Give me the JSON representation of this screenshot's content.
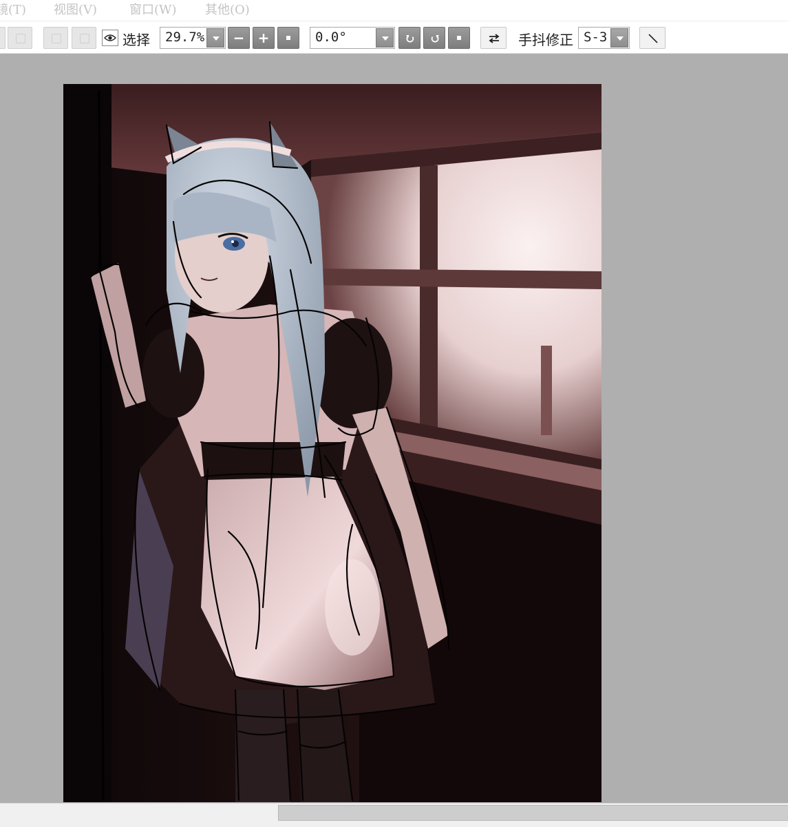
{
  "menu": {
    "items": [
      "镜(T)",
      "视图(V)",
      "窗口(W)",
      "其他(O)"
    ]
  },
  "toolbar": {
    "select_label": "选择",
    "zoom_value": "29.7%",
    "zoom_out_symbol": "−",
    "zoom_in_symbol": "+",
    "rotation_value": "0.0°",
    "stabilizer_label": "手抖修正",
    "stabilizer_value": "S-3"
  },
  "icons": {
    "eye": "eye-icon",
    "rotate_left": "rotate-left-icon",
    "rotate_right": "rotate-right-icon",
    "reset": "stop-icon",
    "flip": "flip-horizontal-icon",
    "line": "straight-line-icon"
  },
  "colors": {
    "workspace": "#afafaf",
    "button_gray": "#8d8d8d",
    "canvas_bg": "#1a0d0e"
  }
}
